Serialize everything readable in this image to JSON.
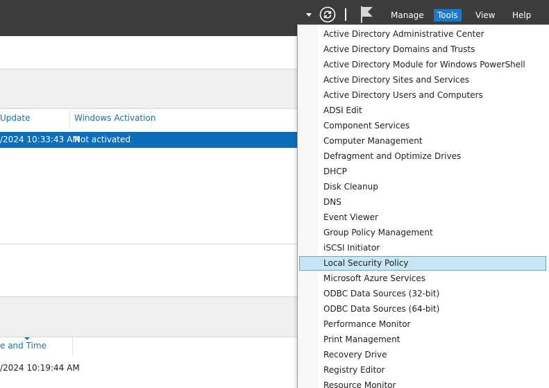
{
  "topbar": {
    "icons": {
      "dropdown": "chevron-down-icon",
      "refresh": "refresh-icon",
      "notifications": "flag-icon"
    },
    "menu": [
      {
        "label": "Manage"
      },
      {
        "label": "Tools",
        "active": true
      },
      {
        "label": "View"
      },
      {
        "label": "Help"
      }
    ],
    "colors": {
      "bar": "#3c3c3c",
      "active": "#1979ca"
    }
  },
  "main": {
    "columns": {
      "update": "Update",
      "activation": "Windows Activation"
    },
    "selected_row": {
      "update": "/2024 10:33:43 AM",
      "activation": "Not activated"
    },
    "lower": {
      "header": "e and Time",
      "value": "/2024 10:19:44 AM"
    },
    "colors": {
      "selection": "#0a6ebd",
      "header_text": "#1b6fb5"
    }
  },
  "tools_menu": {
    "items": [
      "Active Directory Administrative Center",
      "Active Directory Domains and Trusts",
      "Active Directory Module for Windows PowerShell",
      "Active Directory Sites and Services",
      "Active Directory Users and Computers",
      "ADSI Edit",
      "Component Services",
      "Computer Management",
      "Defragment and Optimize Drives",
      "DHCP",
      "Disk Cleanup",
      "DNS",
      "Event Viewer",
      "Group Policy Management",
      "iSCSI Initiator",
      "Local Security Policy",
      "Microsoft Azure Services",
      "ODBC Data Sources (32-bit)",
      "ODBC Data Sources (64-bit)",
      "Performance Monitor",
      "Print Management",
      "Recovery Drive",
      "Registry Editor",
      "Resource Monitor"
    ],
    "highlighted": "Local Security Policy",
    "colors": {
      "highlight": "#c7e6f3",
      "highlight_border": "#5fa8d3"
    }
  }
}
